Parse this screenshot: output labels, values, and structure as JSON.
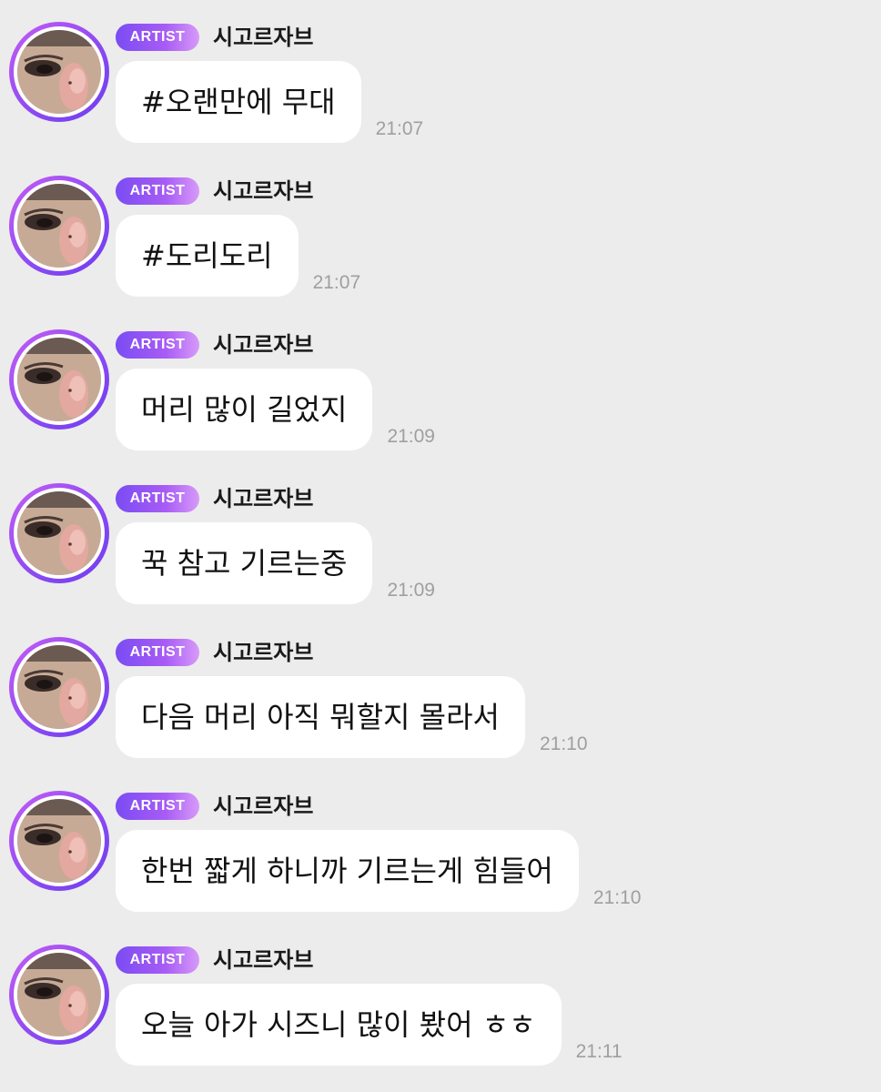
{
  "messages": [
    {
      "badge": "ARTIST",
      "name": "시고르자브",
      "text": "#오랜만에 무대",
      "time": "21:07"
    },
    {
      "badge": "ARTIST",
      "name": "시고르자브",
      "text": "#도리도리",
      "time": "21:07"
    },
    {
      "badge": "ARTIST",
      "name": "시고르자브",
      "text": "머리 많이 길었지",
      "time": "21:09"
    },
    {
      "badge": "ARTIST",
      "name": "시고르자브",
      "text": "꾹 참고 기르는중",
      "time": "21:09"
    },
    {
      "badge": "ARTIST",
      "name": "시고르자브",
      "text": "다음 머리 아직 뭐할지 몰라서",
      "time": "21:10"
    },
    {
      "badge": "ARTIST",
      "name": "시고르자브",
      "text": "한번 짧게 하니까 기르는게 힘들어",
      "time": "21:10"
    },
    {
      "badge": "ARTIST",
      "name": "시고르자브",
      "text": "오늘 아가 시즈니 많이 봤어 ㅎㅎ",
      "time": "21:11"
    }
  ],
  "colors": {
    "background": "#ececec",
    "bubble": "#ffffff",
    "badge_start": "#7a4cf3",
    "badge_end": "#d79af8",
    "avatar_ring": "#a24ef3",
    "timestamp": "#9f9f9f"
  },
  "icons": {
    "avatar": "profile-photo"
  }
}
